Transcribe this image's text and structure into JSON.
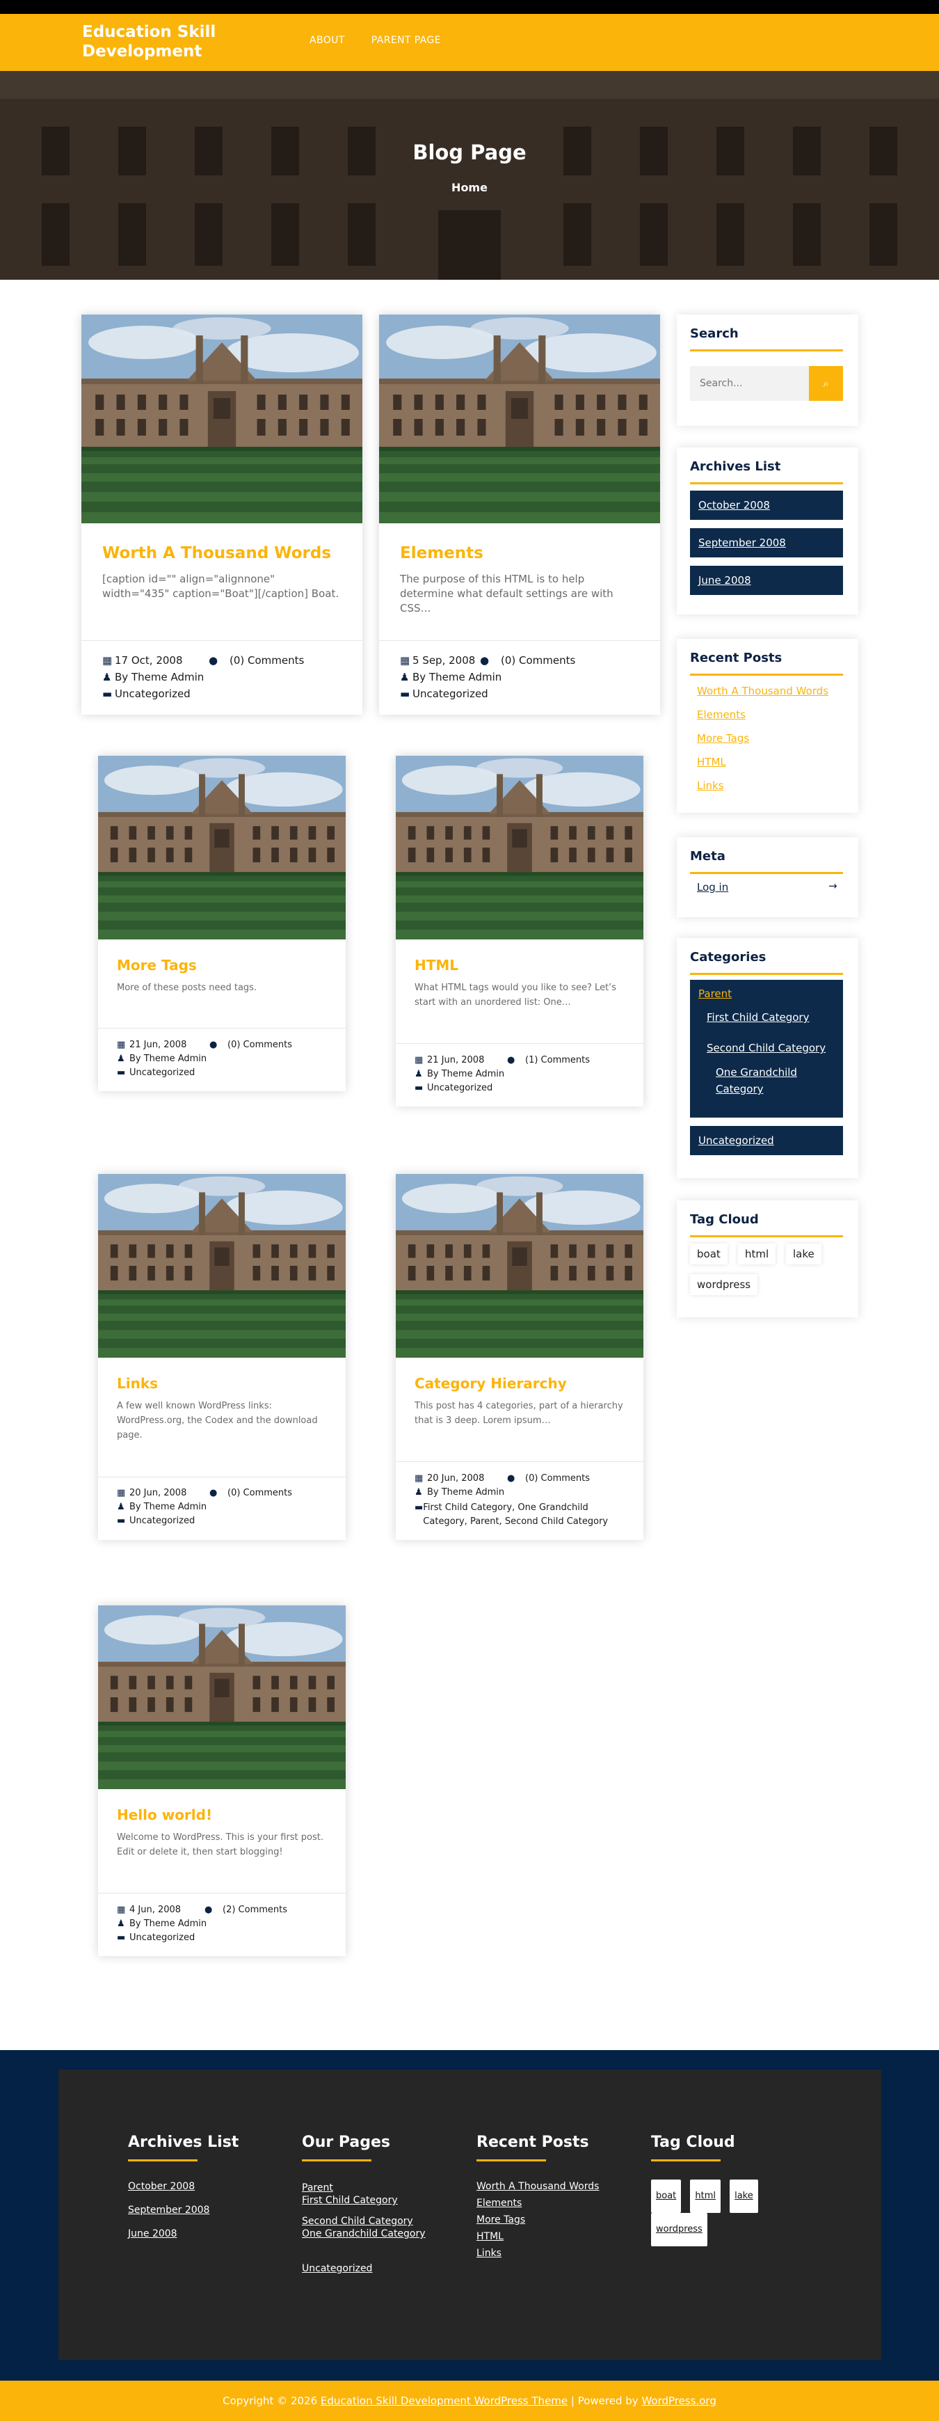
{
  "header": {
    "site_title": "Education Skill Development",
    "nav": [
      "ABOUT",
      "PARENT PAGE"
    ]
  },
  "hero": {
    "title": "Blog Page",
    "breadcrumb": "Home"
  },
  "posts": [
    {
      "title": "Worth A Thousand Words",
      "excerpt": "[caption id=\"\" align=\"alignnone\" width=\"435\" caption=\"Boat\"][/caption] Boat.",
      "date": "17 Oct, 2008",
      "comments": "(0) Comments",
      "author": "By Theme Admin",
      "category": "Uncategorized"
    },
    {
      "title": "Elements",
      "excerpt": "The purpose of this HTML is to help determine what default settings are with CSS…",
      "date": "5 Sep, 2008",
      "comments": "(0) Comments",
      "author": "By Theme Admin",
      "category": "Uncategorized"
    },
    {
      "title": "More Tags",
      "excerpt": "More of these posts need tags.",
      "date": "21 Jun, 2008",
      "comments": "(0) Comments",
      "author": "By Theme Admin",
      "category": "Uncategorized"
    },
    {
      "title": "HTML",
      "excerpt": "What HTML tags would you like to see? Let’s start with an unordered list: One…",
      "date": "21 Jun, 2008",
      "comments": "(1) Comments",
      "author": "By Theme Admin",
      "category": "Uncategorized"
    },
    {
      "title": "Links",
      "excerpt": "A few well known WordPress links: WordPress.org, the Codex and the download page.",
      "date": "20 Jun, 2008",
      "comments": "(0) Comments",
      "author": "By Theme Admin",
      "category": "Uncategorized"
    },
    {
      "title": "Category Hierarchy",
      "excerpt": "This post has 4 categories, part of a hierarchy that is 3 deep. Lorem ipsum…",
      "date": "20 Jun, 2008",
      "comments": "(0) Comments",
      "author": "By Theme Admin",
      "category": "First Child Category, One Grandchild Category, Parent, Second Child Category"
    },
    {
      "title": "Hello world!",
      "excerpt": "Welcome to WordPress. This is your first post. Edit or delete it, then start blogging!",
      "date": "4 Jun, 2008",
      "comments": "(2) Comments",
      "author": "By Theme Admin",
      "category": "Uncategorized"
    }
  ],
  "sidebar": {
    "search": {
      "title": "Search",
      "placeholder": "Search..."
    },
    "archives": {
      "title": "Archives List",
      "items": [
        "October 2008",
        "September 2008",
        "June 2008"
      ]
    },
    "recent": {
      "title": "Recent Posts",
      "items": [
        "Worth A Thousand Words",
        "Elements",
        "More Tags",
        "HTML",
        "Links"
      ]
    },
    "meta": {
      "title": "Meta",
      "login": "Log in",
      "arrow": "→"
    },
    "categories": {
      "title": "Categories",
      "parent": "Parent",
      "child1": "First Child Category",
      "child2": "Second Child Category",
      "grandchild": "One Grandchild Category",
      "uncategorized": "Uncategorized"
    },
    "tags": {
      "title": "Tag Cloud",
      "items": [
        "boat",
        "html",
        "lake",
        "wordpress"
      ]
    }
  },
  "footer": {
    "archives": {
      "title": "Archives List",
      "items": [
        "October 2008",
        "September 2008",
        "June 2008"
      ]
    },
    "pages": {
      "title": "Our Pages",
      "items": [
        "Parent",
        "First Child Category",
        "Second Child Category",
        "One Grandchild Category",
        "Uncategorized"
      ]
    },
    "recent": {
      "title": "Recent Posts",
      "items": [
        "Worth A Thousand Words",
        "Elements",
        "More Tags",
        "HTML",
        "Links"
      ]
    },
    "tags": {
      "title": "Tag Cloud",
      "items": [
        "boat",
        "html",
        "lake",
        "wordpress"
      ]
    }
  },
  "copyright": {
    "prefix": "Copyright © 2026 ",
    "theme_link": "Education Skill Development WordPress Theme",
    "middle": " | Powered by ",
    "wp_link": "WordPress.org"
  },
  "colors": {
    "accent": "#fbb40a",
    "navy": "#0d2a4a",
    "footer_bg": "#032245",
    "footer_inner": "#262626"
  }
}
